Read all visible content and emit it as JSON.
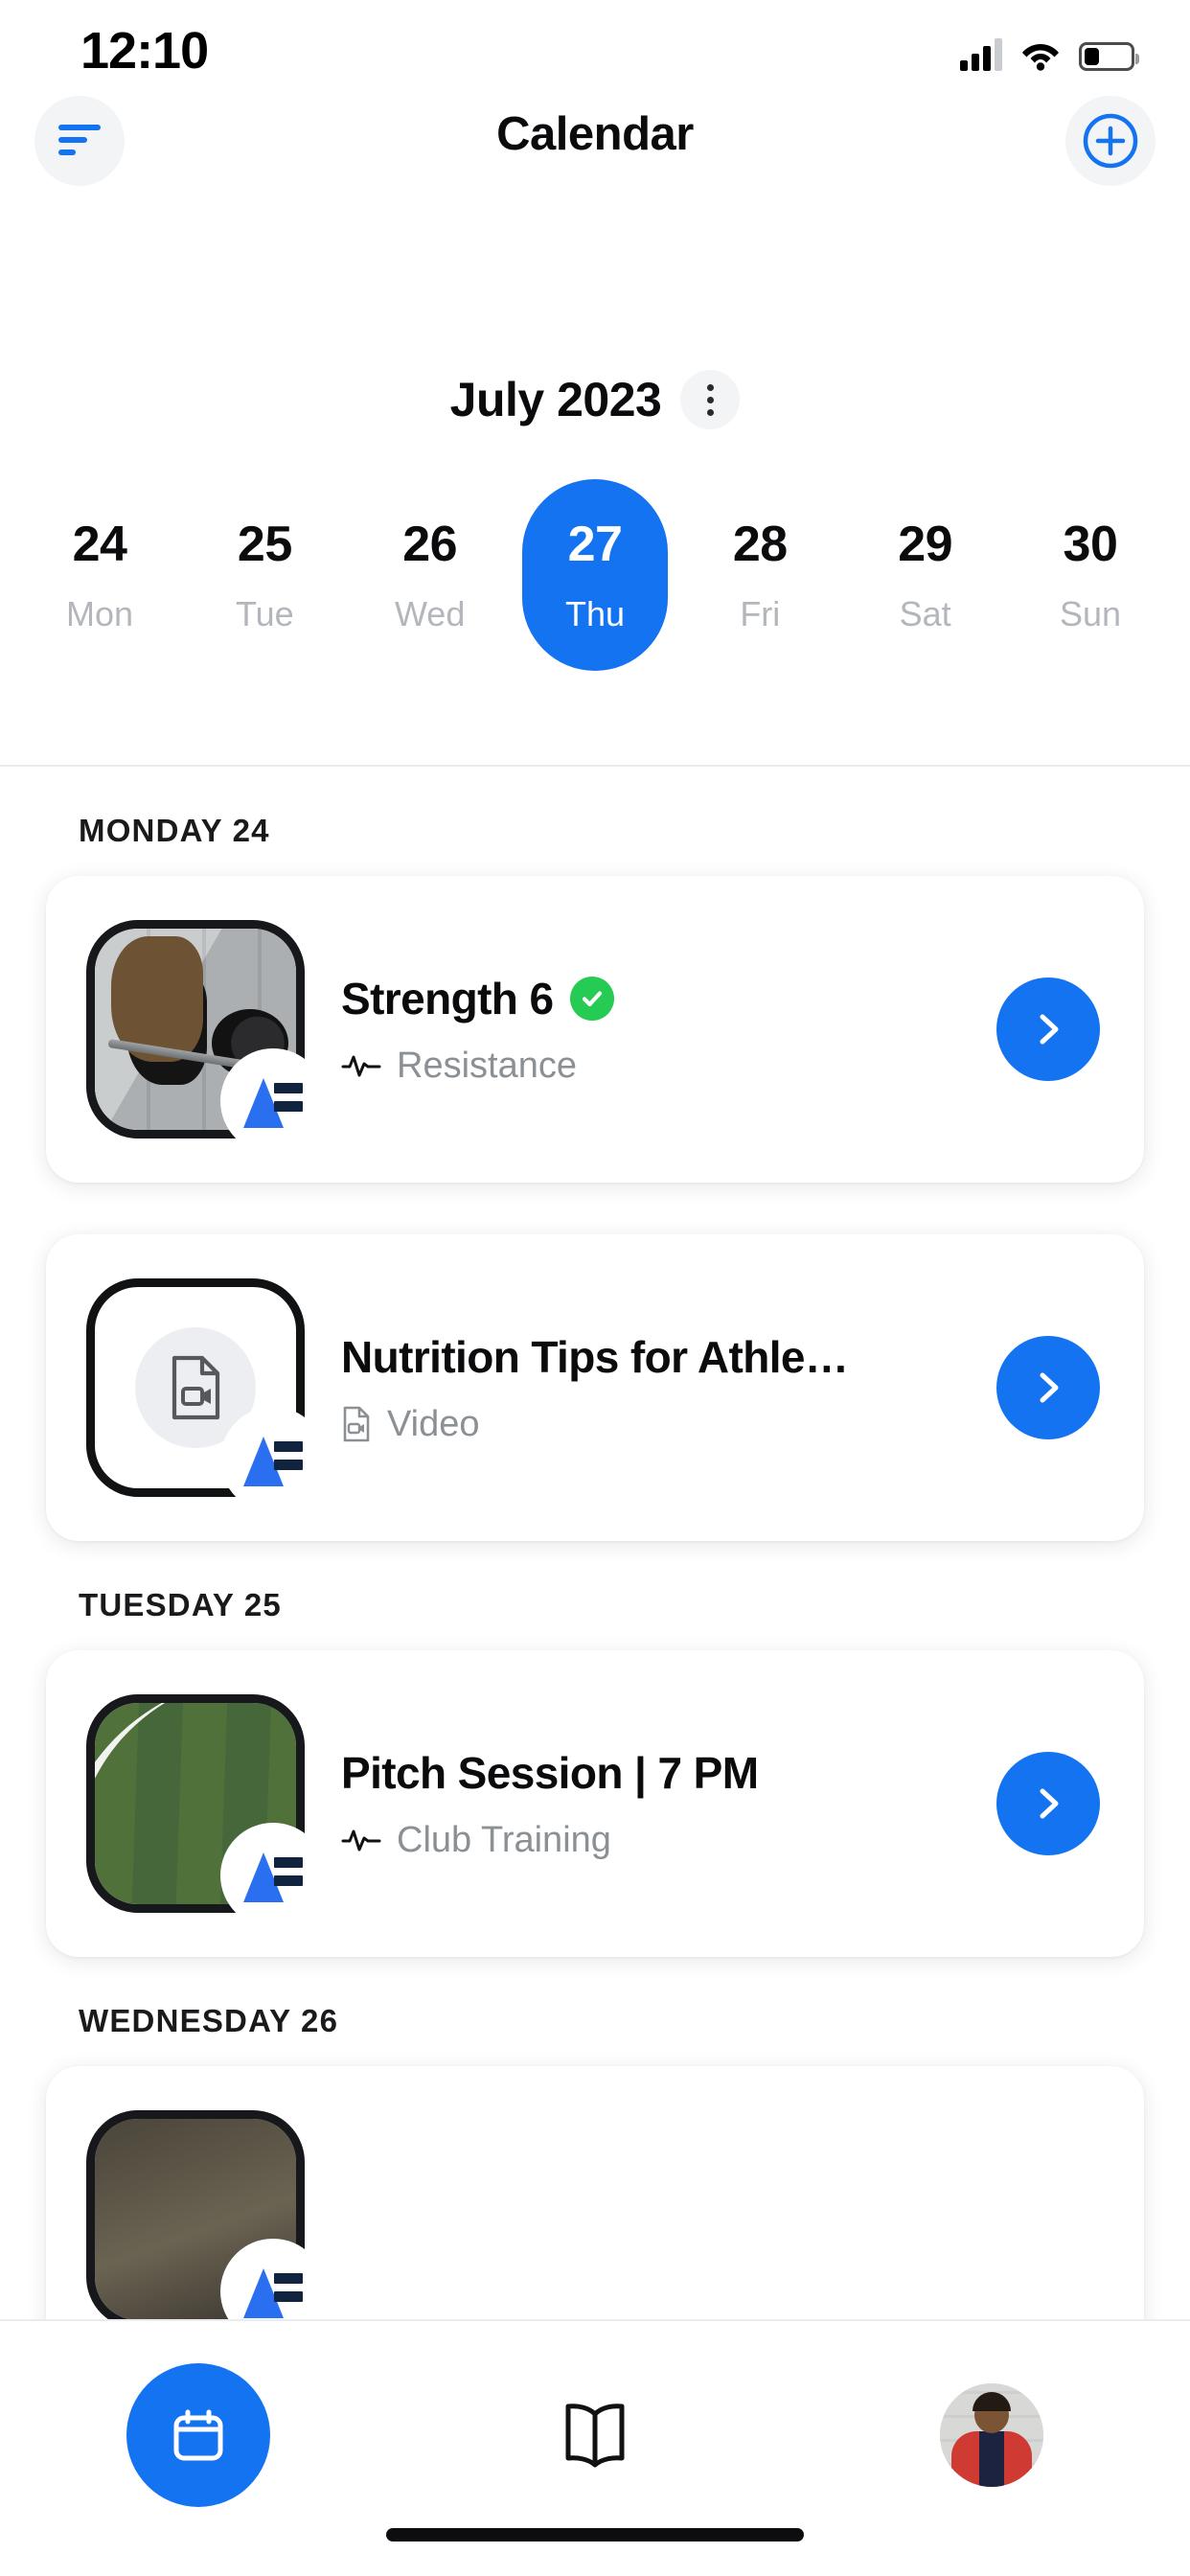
{
  "status_bar": {
    "time": "12:10",
    "signal_icon": "cellular-signal-icon",
    "wifi_icon": "wifi-icon",
    "battery_icon": "battery-low-icon",
    "signal_bars": 3,
    "battery_level_pct": 28
  },
  "header": {
    "title": "Calendar",
    "left_icon": "filter-icon",
    "right_icon": "add-circle-icon"
  },
  "month_selector": {
    "label": "July 2023",
    "menu_icon": "kebab-menu-icon"
  },
  "week_strip": {
    "days": [
      {
        "num": "24",
        "name": "Mon",
        "selected": false
      },
      {
        "num": "25",
        "name": "Tue",
        "selected": false
      },
      {
        "num": "26",
        "name": "Wed",
        "selected": false
      },
      {
        "num": "27",
        "name": "Thu",
        "selected": true
      },
      {
        "num": "28",
        "name": "Fri",
        "selected": false
      },
      {
        "num": "29",
        "name": "Sat",
        "selected": false
      },
      {
        "num": "30",
        "name": "Sun",
        "selected": false
      }
    ]
  },
  "sections": [
    {
      "header": "MONDAY 24",
      "events": [
        {
          "title": "Strength 6",
          "subtitle": "Resistance",
          "subtitle_icon": "activity-pulse-icon",
          "completed": true,
          "thumbnail": "barbell-deadlift-photo",
          "badge": "app-brand-logo",
          "action_icon": "chevron-right-icon"
        },
        {
          "title": "Nutrition Tips for Athle…",
          "subtitle": "Video",
          "subtitle_icon": "file-video-icon",
          "completed": false,
          "thumbnail": "video-placeholder",
          "badge": "app-brand-logo",
          "action_icon": "chevron-right-icon"
        }
      ]
    },
    {
      "header": "TUESDAY 25",
      "events": [
        {
          "title": "Pitch Session | 7 PM",
          "subtitle": "Club Training",
          "subtitle_icon": "activity-pulse-icon",
          "completed": false,
          "thumbnail": "football-pitch-photo",
          "badge": "app-brand-logo",
          "action_icon": "chevron-right-icon"
        }
      ]
    },
    {
      "header": "WEDNESDAY 26",
      "events": [
        {
          "title": "",
          "subtitle": "",
          "subtitle_icon": "",
          "completed": false,
          "thumbnail": "dark-gym-photo",
          "badge": "app-brand-logo",
          "action_icon": "chevron-right-icon"
        }
      ]
    }
  ],
  "bottom_nav": {
    "items": [
      {
        "icon": "calendar-icon",
        "active": true
      },
      {
        "icon": "book-library-icon",
        "active": false
      },
      {
        "icon": "profile-avatar",
        "active": false
      }
    ]
  },
  "colors": {
    "accent_blue": "#1373f0",
    "success_green": "#25cb52",
    "muted_text": "#8b9095",
    "day_muted": "#b3b6bb",
    "card_bg": "#ffffff",
    "page_bg": "#ffffff",
    "divider": "#e9ebee"
  }
}
